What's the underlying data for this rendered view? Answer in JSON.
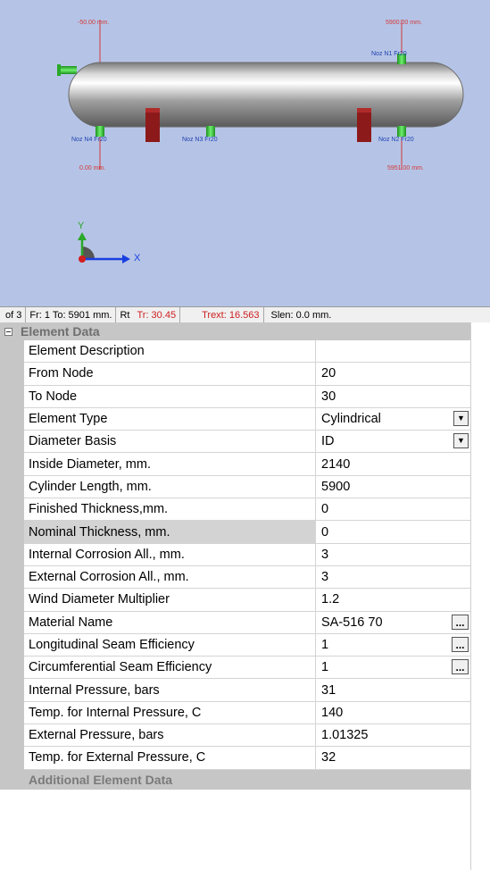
{
  "viewport": {
    "dim_top_left": "-50.00 mm.",
    "dim_top_right": "5900.00 mm.",
    "dim_bottom_left": "0.00 mm.",
    "dim_bottom_right": "5951.00 mm.",
    "noz_top": "Noz N1 Fr20",
    "noz_bottom_left": "Noz N4 Fr20",
    "noz_bottom_mid": "Noz N3 Fr20",
    "noz_bottom_right": "Noz N2 Fr20",
    "axis_y": "Y",
    "axis_x": "X"
  },
  "status": {
    "page": "of 3",
    "from_to": "Fr: 1 To: 5901 mm.",
    "rt": "Rt",
    "tr": "Tr: 30.45",
    "trext": "Trext: 16.563",
    "slen": "Slen: 0.0 mm."
  },
  "grid": {
    "section_title": "Element Data",
    "rows": [
      {
        "label": "Element Description",
        "value": ""
      },
      {
        "label": "From Node",
        "value": "20"
      },
      {
        "label": "To Node",
        "value": "30"
      },
      {
        "label": "Element Type",
        "value": "Cylindrical"
      },
      {
        "label": "Diameter Basis",
        "value": "ID"
      },
      {
        "label": "Inside Diameter, mm.",
        "value": "2140"
      },
      {
        "label": "Cylinder Length, mm.",
        "value": "5900"
      },
      {
        "label": "Finished Thickness,mm.",
        "value": "0"
      },
      {
        "label": "Nominal Thickness, mm.",
        "value": "0"
      },
      {
        "label": "Internal Corrosion All., mm.",
        "value": "3"
      },
      {
        "label": "External Corrosion All., mm.",
        "value": "3"
      },
      {
        "label": "Wind Diameter Multiplier",
        "value": "1.2"
      },
      {
        "label": "Material Name",
        "value": "SA-516 70"
      },
      {
        "label": "Longitudinal Seam Efficiency",
        "value": "1"
      },
      {
        "label": "Circumferential Seam Efficiency",
        "value": "1"
      },
      {
        "label": "Internal Pressure, bars",
        "value": "31"
      },
      {
        "label": "Temp. for Internal Pressure, C",
        "value": "140"
      },
      {
        "label": "External Pressure, bars",
        "value": "1.01325"
      },
      {
        "label": "Temp. for External Pressure, C",
        "value": "32"
      }
    ],
    "dropdown_glyph": "▼",
    "ellipsis_glyph": "...",
    "additional_title": "Additional Element Data"
  },
  "colors": {
    "viewport_bg": "#b5c4e6",
    "dimension_line": "#d23a3a",
    "nozzle": "#3cc63c",
    "saddle": "#8c1a1a"
  }
}
